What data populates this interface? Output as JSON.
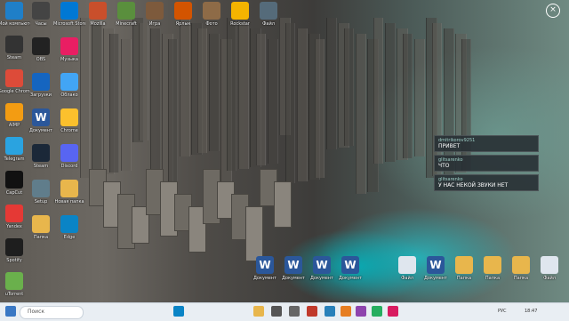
{
  "desktop": {
    "icons_left": [
      {
        "label": "Мой компьютер",
        "icon": "monitor-icon",
        "color": "#1f7fc8"
      },
      {
        "label": "Steam",
        "icon": "clock-icon",
        "color": "#333333"
      },
      {
        "label": "Google Chrome",
        "icon": "chrome-icon",
        "color": "#dd4b39"
      },
      {
        "label": "AIMP",
        "icon": "aimp-icon",
        "color": "#f39c12"
      },
      {
        "label": "Telegram",
        "icon": "telegram-icon",
        "color": "#2aa3e0"
      },
      {
        "label": "CapCut",
        "icon": "capcut-icon",
        "color": "#111111"
      },
      {
        "label": "Yandex",
        "icon": "yandex-icon",
        "color": "#e53935"
      },
      {
        "label": "Spotify",
        "icon": "game-icon",
        "color": "#1e1e1e"
      },
      {
        "label": "uTorrent",
        "icon": "utorrent-icon",
        "color": "#6ab04c"
      }
    ],
    "icons_col2": [
      {
        "label": "Часы",
        "icon": "clock-icon",
        "color": "#444444"
      },
      {
        "label": "OBS",
        "icon": "obs-icon",
        "color": "#222222"
      },
      {
        "label": "Загрузки",
        "icon": "download-icon",
        "color": "#1565c0"
      },
      {
        "label": "Документ",
        "icon": "word-icon",
        "color": "#2b579a"
      },
      {
        "label": "Steam",
        "icon": "steam-icon",
        "color": "#1b2838"
      },
      {
        "label": "Setup",
        "icon": "setup-icon",
        "color": "#607d8b"
      },
      {
        "label": "Папка",
        "icon": "folder-icon",
        "color": "#e8b64c"
      }
    ],
    "icons_col3": [
      {
        "label": "Microsoft Store",
        "icon": "store-icon",
        "color": "#0078d4"
      },
      {
        "label": "Музыка",
        "icon": "music-icon",
        "color": "#e91e63"
      },
      {
        "label": "Облако",
        "icon": "cloud-icon",
        "color": "#42a5f5"
      },
      {
        "label": "Chrome",
        "icon": "chrome-icon",
        "color": "#fbc02d"
      },
      {
        "label": "Discord",
        "icon": "discord-icon",
        "color": "#5865f2"
      },
      {
        "label": "Новая папка",
        "icon": "folder-icon",
        "color": "#e8b64c"
      },
      {
        "label": "Edge",
        "icon": "edge-icon",
        "color": "#0a84c6"
      }
    ],
    "icons_top": [
      {
        "label": "Mozilla",
        "icon": "app-icon",
        "color": "#c94f2b"
      },
      {
        "label": "Minecraft",
        "icon": "app-icon",
        "color": "#5a8f3d"
      },
      {
        "label": "Игра",
        "icon": "app-icon",
        "color": "#7d5a3c"
      },
      {
        "label": "Ярлык",
        "icon": "app-icon",
        "color": "#d35400"
      },
      {
        "label": "Фото",
        "icon": "app-icon",
        "color": "#8e6b47"
      },
      {
        "label": "Rockstar",
        "icon": "rockstar-icon",
        "color": "#f4b400"
      },
      {
        "label": "Файл",
        "icon": "app-icon",
        "color": "#556b7a"
      }
    ],
    "icons_bottom": [
      {
        "label": "Документ",
        "icon": "word-icon"
      },
      {
        "label": "Документ",
        "icon": "word-icon"
      },
      {
        "label": "Документ",
        "icon": "word-icon"
      },
      {
        "label": "Документ",
        "icon": "word-icon"
      },
      {
        "label": "Файл",
        "icon": "file-icon"
      },
      {
        "label": "Документ",
        "icon": "word-icon"
      },
      {
        "label": "Папка",
        "icon": "folder-icon"
      },
      {
        "label": "Папка",
        "icon": "folder-icon"
      },
      {
        "label": "Папка",
        "icon": "folder-icon"
      },
      {
        "label": "Файл",
        "icon": "file-icon"
      }
    ]
  },
  "chat": [
    {
      "author": "dmitrikorov9251",
      "text": "ПРИВЕТ"
    },
    {
      "author": "glitsarenko",
      "text": "ЧТО"
    },
    {
      "author": "glitsarenko",
      "text": "У НАС НЕКОЙ ЗВУКИ НЕТ"
    }
  ],
  "taskbar": {
    "search_placeholder": "Поиск",
    "tray_lang": "РУС",
    "time": "18:47"
  }
}
